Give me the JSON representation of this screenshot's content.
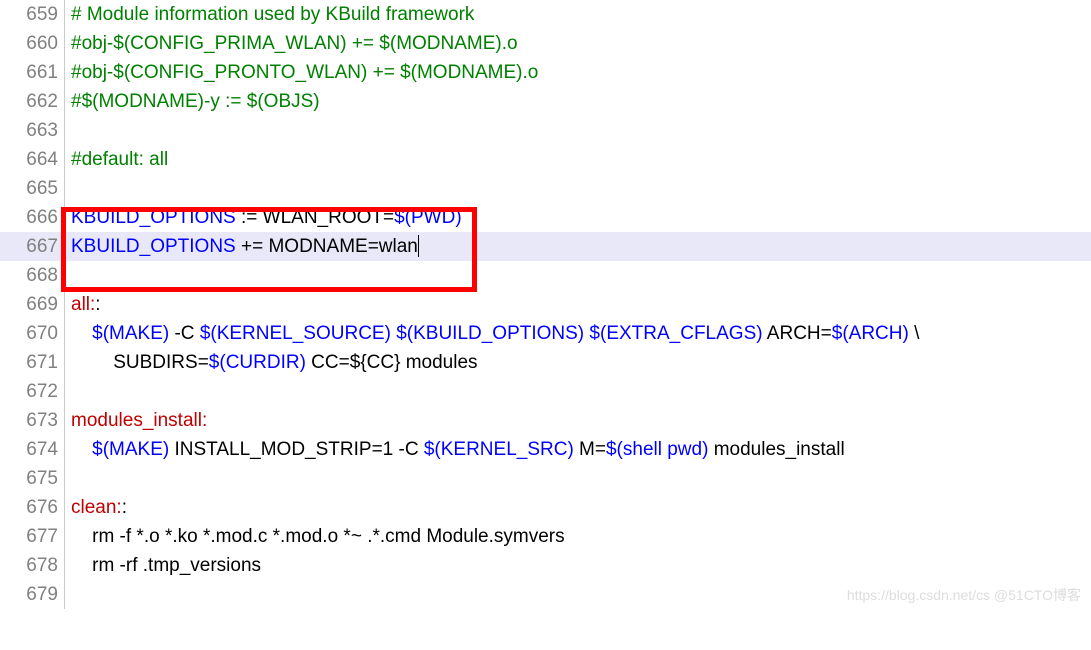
{
  "watermark": "https://blog.csdn.net/cs   @51CTO博客",
  "lines": [
    {
      "num": "659",
      "active": false,
      "segments": [
        {
          "class": "c-green",
          "text": "# Module information used by KBuild framework"
        }
      ]
    },
    {
      "num": "660",
      "active": false,
      "segments": [
        {
          "class": "c-green",
          "text": "#obj-$(CONFIG_PRIMA_WLAN) += $(MODNAME).o"
        }
      ]
    },
    {
      "num": "661",
      "active": false,
      "segments": [
        {
          "class": "c-green",
          "text": "#obj-$(CONFIG_PRONTO_WLAN) += $(MODNAME).o"
        }
      ]
    },
    {
      "num": "662",
      "active": false,
      "segments": [
        {
          "class": "c-green",
          "text": "#$(MODNAME)-y := $(OBJS)"
        }
      ]
    },
    {
      "num": "663",
      "active": false,
      "segments": []
    },
    {
      "num": "664",
      "active": false,
      "segments": [
        {
          "class": "c-green",
          "text": "#default: all"
        }
      ]
    },
    {
      "num": "665",
      "active": false,
      "segments": []
    },
    {
      "num": "666",
      "active": false,
      "segments": [
        {
          "class": "c-blue",
          "text": "KBUILD_OPTIONS"
        },
        {
          "class": "c-black",
          "text": " := WLAN_ROOT="
        },
        {
          "class": "c-blue",
          "text": "$(PWD)"
        }
      ]
    },
    {
      "num": "667",
      "active": true,
      "segments": [
        {
          "class": "c-blue",
          "text": "KBUILD_OPTIONS"
        },
        {
          "class": "c-black",
          "text": " += MODNAME=wlan"
        }
      ],
      "cursor": true
    },
    {
      "num": "668",
      "active": false,
      "segments": []
    },
    {
      "num": "669",
      "active": false,
      "segments": [
        {
          "class": "c-red",
          "text": "all:"
        },
        {
          "class": "c-black",
          "text": ":"
        }
      ]
    },
    {
      "num": "670",
      "active": false,
      "segments": [
        {
          "class": "c-black",
          "text": "    "
        },
        {
          "class": "c-blue",
          "text": "$(MAKE)"
        },
        {
          "class": "c-black",
          "text": " -C "
        },
        {
          "class": "c-blue",
          "text": "$(KERNEL_SOURCE)"
        },
        {
          "class": "c-black",
          "text": " "
        },
        {
          "class": "c-blue",
          "text": "$(KBUILD_OPTIONS)"
        },
        {
          "class": "c-black",
          "text": " "
        },
        {
          "class": "c-blue",
          "text": "$(EXTRA_CFLAGS)"
        },
        {
          "class": "c-black",
          "text": " ARCH="
        },
        {
          "class": "c-blue",
          "text": "$(ARCH)"
        },
        {
          "class": "c-black",
          "text": " \\"
        }
      ]
    },
    {
      "num": "671",
      "active": false,
      "segments": [
        {
          "class": "c-black",
          "text": "        SUBDIRS="
        },
        {
          "class": "c-blue",
          "text": "$(CURDIR)"
        },
        {
          "class": "c-black",
          "text": " CC=${CC} modules"
        }
      ]
    },
    {
      "num": "672",
      "active": false,
      "segments": []
    },
    {
      "num": "673",
      "active": false,
      "segments": [
        {
          "class": "c-red",
          "text": "modules_install:"
        }
      ]
    },
    {
      "num": "674",
      "active": false,
      "segments": [
        {
          "class": "c-black",
          "text": "    "
        },
        {
          "class": "c-blue",
          "text": "$(MAKE)"
        },
        {
          "class": "c-black",
          "text": " INSTALL_MOD_STRIP=1 -C "
        },
        {
          "class": "c-blue",
          "text": "$(KERNEL_SRC)"
        },
        {
          "class": "c-black",
          "text": " M="
        },
        {
          "class": "c-blue",
          "text": "$(shell pwd)"
        },
        {
          "class": "c-black",
          "text": " modules_install"
        }
      ]
    },
    {
      "num": "675",
      "active": false,
      "segments": []
    },
    {
      "num": "676",
      "active": false,
      "segments": [
        {
          "class": "c-red",
          "text": "clean:"
        },
        {
          "class": "c-black",
          "text": ":"
        }
      ]
    },
    {
      "num": "677",
      "active": false,
      "segments": [
        {
          "class": "c-black",
          "text": "    rm -f *.o *.ko *.mod.c *.mod.o *~ .*.cmd Module.symvers"
        }
      ]
    },
    {
      "num": "678",
      "active": false,
      "segments": [
        {
          "class": "c-black",
          "text": "    rm -rf .tmp_versions"
        }
      ]
    },
    {
      "num": "679",
      "active": false,
      "segments": []
    }
  ]
}
